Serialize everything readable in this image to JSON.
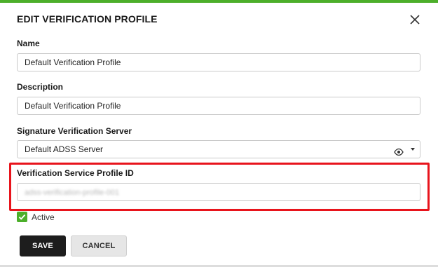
{
  "dialog": {
    "title": "EDIT VERIFICATION PROFILE",
    "accent_color": "#4caf2a",
    "close_icon": "close-icon"
  },
  "form": {
    "name": {
      "label": "Name",
      "value": "Default Verification Profile"
    },
    "description": {
      "label": "Description",
      "value": "Default Verification Profile"
    },
    "server": {
      "label": "Signature Verification Server",
      "value": "Default ADSS Server",
      "view_icon": "eye-icon",
      "dropdown_icon": "caret-down-icon"
    },
    "service_profile": {
      "label": "Verification Service Profile ID",
      "value": "adss-verification-profile-001",
      "highlight_color": "#e8141c"
    },
    "active": {
      "label": "Active",
      "checked": true
    }
  },
  "buttons": {
    "save": "SAVE",
    "cancel": "CANCEL"
  }
}
